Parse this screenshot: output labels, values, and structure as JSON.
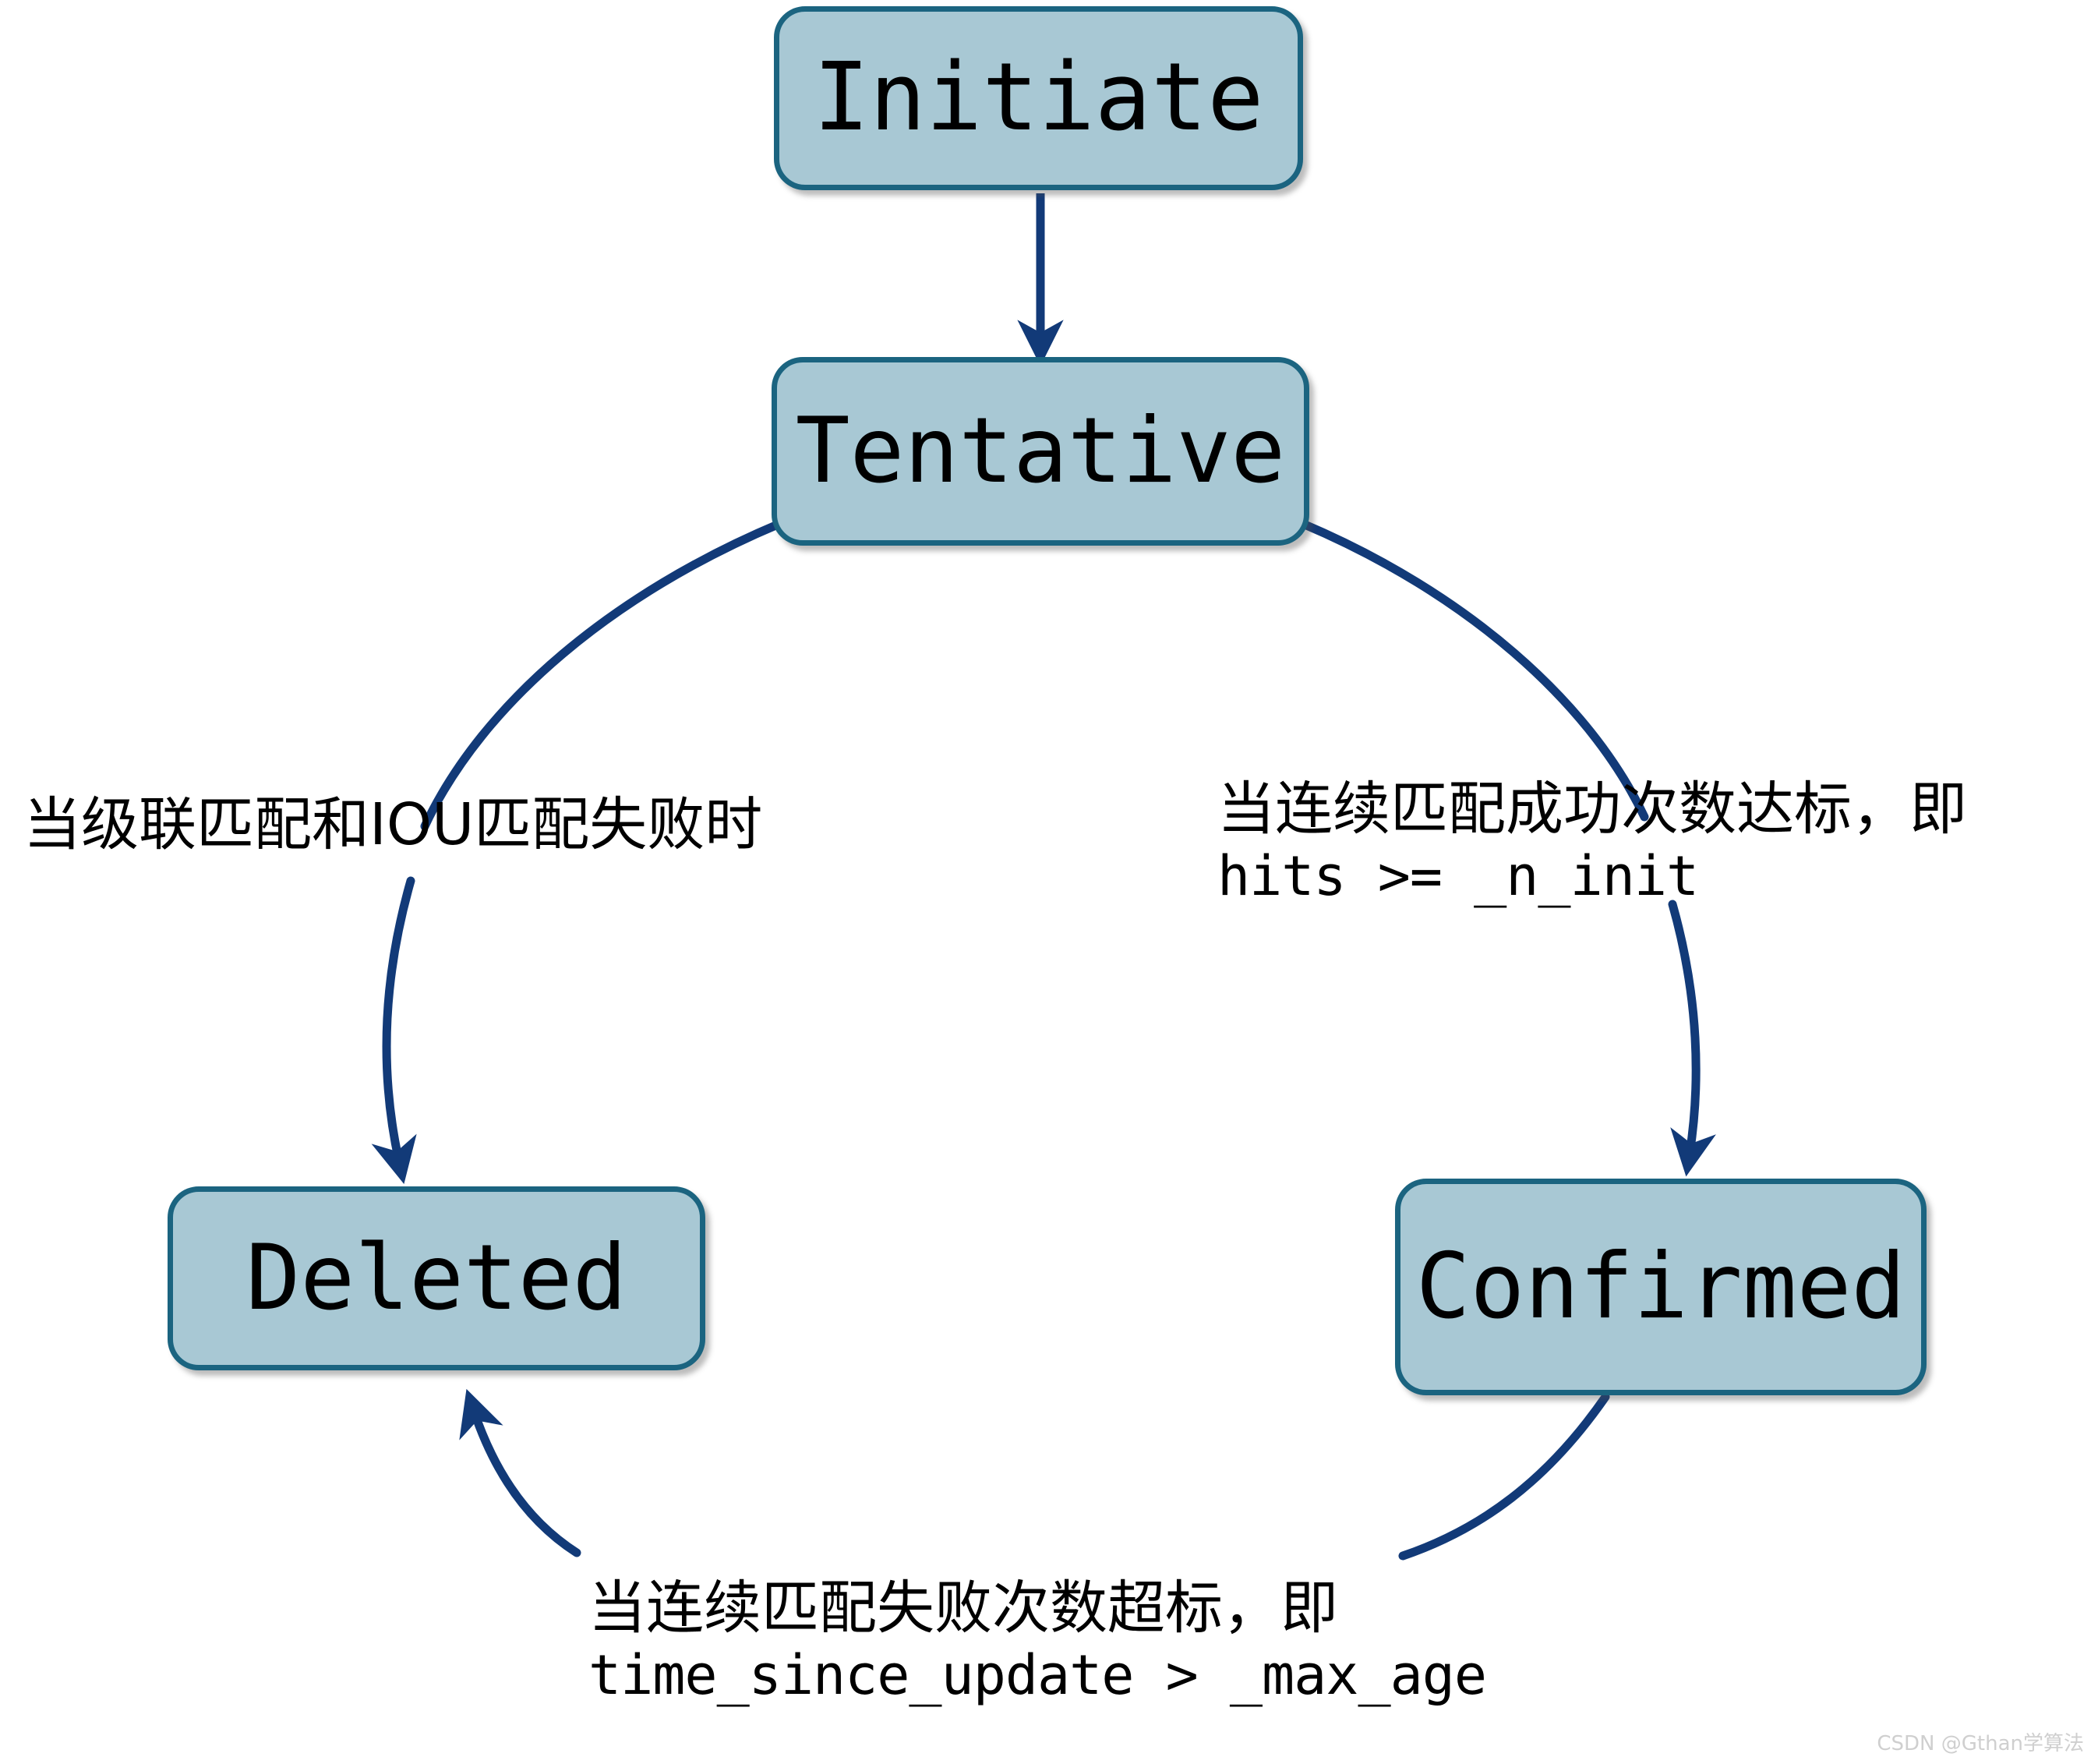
{
  "diagram": {
    "title": "Track state transition diagram",
    "colors": {
      "node_fill": "#a8c8d4",
      "node_border": "#1b6480",
      "edge": "#123a78",
      "text": "#000000",
      "background": "#ffffff",
      "watermark": "#cfcfcf"
    },
    "nodes": [
      {
        "id": "initiate",
        "label": "Initiate"
      },
      {
        "id": "tentative",
        "label": "Tentative"
      },
      {
        "id": "deleted",
        "label": "Deleted"
      },
      {
        "id": "confirmed",
        "label": "Confirmed"
      }
    ],
    "edges": [
      {
        "id": "initiate-tentative",
        "from": "Initiate",
        "to": "Tentative",
        "shape": "straight-down-arrow",
        "label_lines": []
      },
      {
        "id": "tentative-deleted",
        "from": "Tentative",
        "to": "Deleted",
        "shape": "left-arc-down-arrow",
        "label_lines": [
          "当级联匹配和IOU匹配失败时"
        ]
      },
      {
        "id": "tentative-confirmed",
        "from": "Tentative",
        "to": "Confirmed",
        "shape": "right-arc-down-arrow",
        "label_lines": [
          "当连续匹配成功次数达标，即",
          "hits >= _n_init"
        ]
      },
      {
        "id": "confirmed-deleted",
        "from": "Confirmed",
        "to": "Deleted",
        "shape": "bottom-arc-up-arrow",
        "label_lines": [
          "当连续匹配失败次数超标，即",
          "time_since_update > _max_age"
        ]
      }
    ],
    "labels": {
      "tentative_deleted_zh": "当级联匹配和IOU匹配失败时",
      "tentative_confirmed_zh": "当连续匹配成功次数达标，即",
      "tentative_confirmed_code": "hits >= _n_init",
      "confirmed_deleted_zh": "当连续匹配失败次数超标，即",
      "confirmed_deleted_code": "time_since_update > _max_age"
    },
    "watermark": "CSDN @Gthan学算法"
  }
}
